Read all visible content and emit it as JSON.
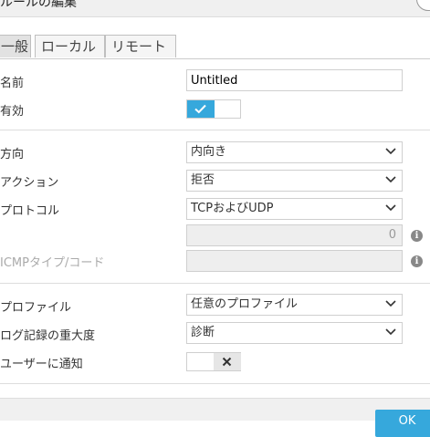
{
  "dialog": {
    "title": "ルールの編集"
  },
  "tabs": [
    {
      "label": "一般",
      "active": true
    },
    {
      "label": "ローカル",
      "active": false
    },
    {
      "label": "リモート",
      "active": false
    }
  ],
  "form": {
    "name": {
      "label": "名前",
      "value": "Untitled"
    },
    "enabled": {
      "label": "有効",
      "checked": true
    },
    "direction": {
      "label": "方向",
      "value": "内向き"
    },
    "action": {
      "label": "アクション",
      "value": "拒否"
    },
    "protocol": {
      "label": "プロトコル",
      "value": "TCPおよびUDP"
    },
    "protocol_number": {
      "value": "0"
    },
    "icmp": {
      "label": "ICMPタイプ/コード",
      "value": ""
    },
    "profile": {
      "label": "プロファイル",
      "value": "任意のプロファイル"
    },
    "log_severity": {
      "label": "ログ記録の重大度",
      "value": "診断"
    },
    "notify_user": {
      "label": "ユーザーに通知",
      "checked": false
    }
  },
  "info_icon": "i",
  "footer": {
    "ok_label": "OK"
  },
  "colors": {
    "accent": "#36a8dc"
  }
}
